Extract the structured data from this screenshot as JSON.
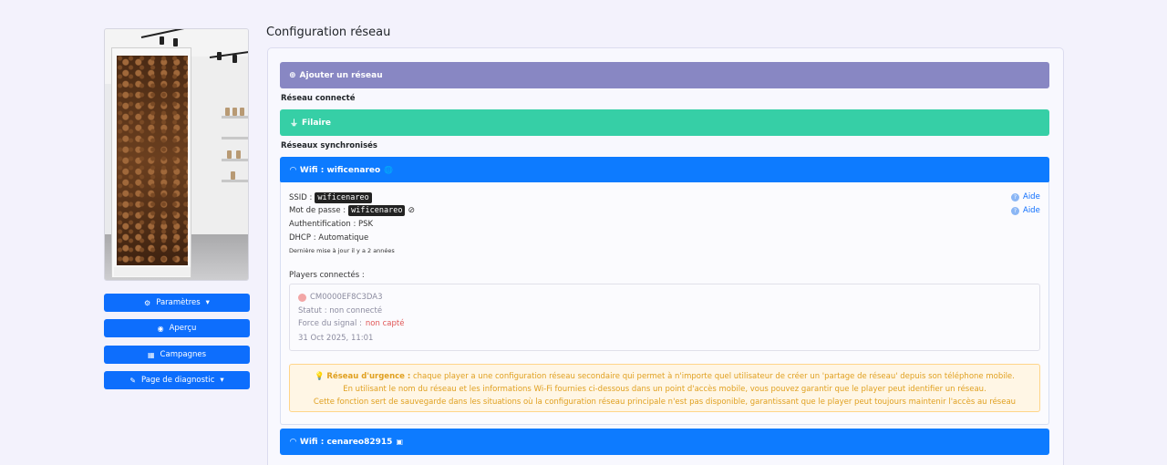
{
  "sidebar": {
    "buttons": [
      {
        "label": "Paramètres",
        "icon": "gears-icon",
        "caret": "▾"
      },
      {
        "label": "Aperçu",
        "icon": "eye-icon",
        "caret": ""
      },
      {
        "label": "Campagnes",
        "icon": "campaigns-icon",
        "caret": ""
      },
      {
        "label": "Page de diagnostic",
        "icon": "wrench-icon",
        "caret": "▾"
      }
    ]
  },
  "main": {
    "title": "Configuration réseau",
    "add_network": "Ajouter un réseau",
    "connected_label": "Réseau connecté",
    "wired_label": "Filaire",
    "synced_label": "Réseaux synchronisés",
    "wifi1": {
      "title": "Wifi : wificenareo",
      "ssid_label": "SSID :",
      "ssid": "wificenareo",
      "password_label": "Mot de passe :",
      "password": "wificenareo",
      "auth": "Authentification : PSK",
      "dhcp": "DHCP : Automatique",
      "updated": "Dernière mise à jour il y a 2 années",
      "help": "Aide",
      "players_label": "Players connectés :",
      "player": {
        "id": "CM0000EF8C3DA3",
        "status": "Statut : non connecté",
        "signal_label": "Force du signal :",
        "signal_value": "non capté",
        "date": "31 Oct 2025, 11:01"
      },
      "warning": {
        "strong": "Réseau d'urgence :",
        "line1": "chaque player a une configuration réseau secondaire qui permet à n'importe quel utilisateur de créer un 'partage de réseau' depuis son téléphone mobile.",
        "line2": "En utilisant le nom du réseau et les informations Wi-Fi fournies ci-dessous dans un point d'accès mobile, vous pouvez garantir que le player peut identifier un réseau.",
        "line3": "Cette fonction sert de sauvegarde dans les situations où la configuration réseau principale n'est pas disponible, garantissant que le player peut toujours maintenir l'accès au réseau"
      }
    },
    "wifi2": {
      "title": "Wifi : cenareo82915"
    }
  },
  "colors": {
    "primary": "#0d7bff",
    "add_bar": "#8887c3",
    "wired_bar": "#36cfa6",
    "warning_text": "#e0a020",
    "warning_bg": "#fff6e5"
  }
}
